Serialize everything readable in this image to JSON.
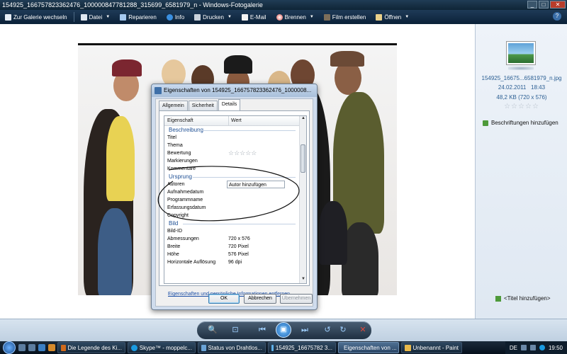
{
  "window": {
    "title": "154925_166757823362476_100000847781288_315699_6581979_n - Windows-Fotogalerie",
    "controls": [
      "_",
      "□",
      "✕"
    ]
  },
  "toolbar": {
    "back_label": "Zur Galerie wechseln",
    "items": [
      {
        "label": "Datei",
        "icon": "file-icon",
        "dropdown": true
      },
      {
        "label": "Reparieren",
        "icon": "repair-icon",
        "dropdown": false
      },
      {
        "label": "Info",
        "icon": "info-icon",
        "dropdown": false
      },
      {
        "label": "Drucken",
        "icon": "print-icon",
        "dropdown": true
      },
      {
        "label": "E-Mail",
        "icon": "email-icon",
        "dropdown": false
      },
      {
        "label": "Brennen",
        "icon": "burn-icon",
        "dropdown": true
      },
      {
        "label": "Film erstellen",
        "icon": "film-icon",
        "dropdown": false
      },
      {
        "label": "Öffnen",
        "icon": "open-icon",
        "dropdown": true
      }
    ],
    "help": "?"
  },
  "info_pane": {
    "filename": "154925_16675...6581979_n.jpg",
    "date": "24.02.2011",
    "time": "18:43",
    "size": "48,2 KB (720 x 576)",
    "stars": "☆☆☆☆☆",
    "add_tags": "Beschriftungen hinzufügen",
    "add_title": "<Titel hinzufügen>"
  },
  "dialog": {
    "title": "Eigenschaften von 154925_166757823362476_1000008...",
    "tabs": [
      "Allgemein",
      "Sicherheit",
      "Details"
    ],
    "active_tab": 2,
    "col_property": "Eigenschaft",
    "col_value": "Wert",
    "rows": [
      {
        "type": "section",
        "key": "Beschreibung"
      },
      {
        "type": "prop",
        "key": "Titel",
        "value": ""
      },
      {
        "type": "prop",
        "key": "Thema",
        "value": ""
      },
      {
        "type": "rating",
        "key": "Bewertung",
        "value": "☆☆☆☆☆"
      },
      {
        "type": "prop",
        "key": "Markierungen",
        "value": ""
      },
      {
        "type": "prop",
        "key": "Kommentare",
        "value": ""
      },
      {
        "type": "section",
        "key": "Ursprung"
      },
      {
        "type": "field",
        "key": "Autoren",
        "value": "Autor hinzufügen"
      },
      {
        "type": "prop",
        "key": "Aufnahmedatum",
        "value": ""
      },
      {
        "type": "prop",
        "key": "Programmname",
        "value": ""
      },
      {
        "type": "prop",
        "key": "Erfassungsdatum",
        "value": ""
      },
      {
        "type": "prop",
        "key": "Copyright",
        "value": ""
      },
      {
        "type": "section",
        "key": "Bild"
      },
      {
        "type": "prop",
        "key": "Bild-ID",
        "value": ""
      },
      {
        "type": "prop",
        "key": "Abmessungen",
        "value": "720 x 576"
      },
      {
        "type": "prop",
        "key": "Breite",
        "value": "720 Pixel"
      },
      {
        "type": "prop",
        "key": "Höhe",
        "value": "576 Pixel"
      },
      {
        "type": "prop",
        "key": "Horizontale Auflösung",
        "value": "96 dpi"
      }
    ],
    "remove_link": "Eigenschaften und persönliche Informationen entfernen",
    "ok": "OK",
    "cancel": "Abbrechen",
    "apply": "Übernehmen"
  },
  "playback": {
    "buttons": [
      "zoom-icon",
      "fit-icon",
      "previous-icon",
      "slideshow-icon",
      "next-icon",
      "rotate-left-icon",
      "rotate-right-icon",
      "delete-icon"
    ]
  },
  "taskbar": {
    "tasks": [
      {
        "label": "Die Legende des Ki...",
        "icon_color": "#d06a1c",
        "active": false
      },
      {
        "label": "Skype™ - moppelc...",
        "icon_color": "#1a9ae0",
        "active": false
      },
      {
        "label": "Status von Drahtlos...",
        "icon_color": "#6aa3d6",
        "active": false
      },
      {
        "label": "154925_16675782 3...",
        "icon_color": "#5fb0e8",
        "active": false
      },
      {
        "label": "Eigenschaften von ...",
        "icon_color": "#3e6fa8",
        "active": true
      },
      {
        "label": "Unbenannt - Paint",
        "icon_color": "#e8b84a",
        "active": false
      }
    ],
    "lang": "DE",
    "clock": "19:50"
  }
}
